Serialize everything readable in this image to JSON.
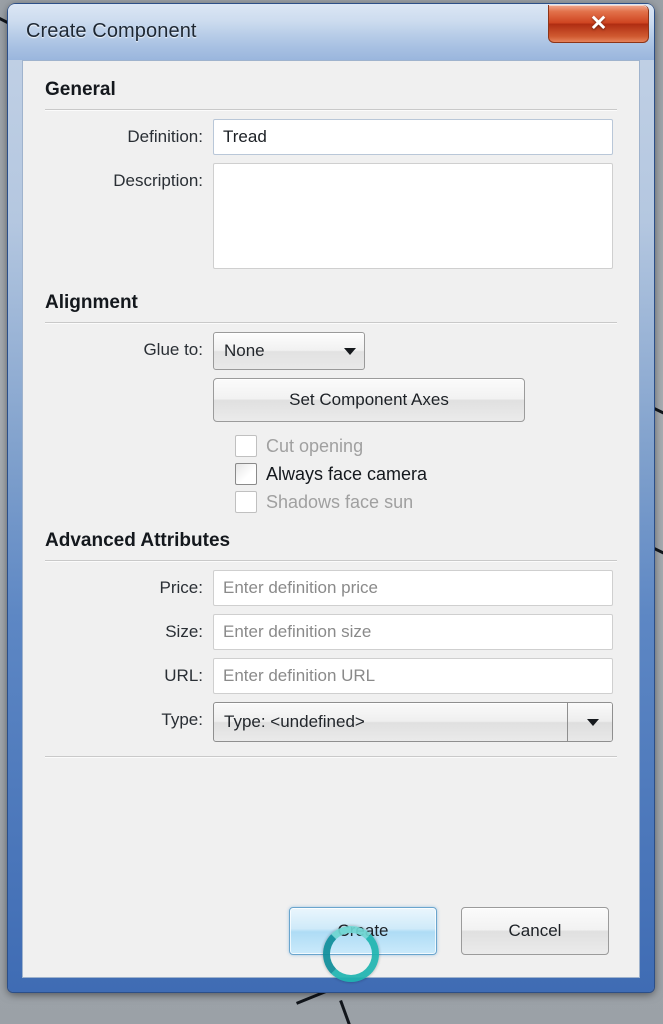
{
  "window": {
    "title": "Create Component",
    "close_label": "✕",
    "accent_color": "#3f6cb4",
    "close_color": "#cf4521"
  },
  "sections": {
    "general": {
      "title": "General",
      "definition": {
        "label": "Definition:",
        "value": "Tread"
      },
      "description": {
        "label": "Description:",
        "value": ""
      }
    },
    "alignment": {
      "title": "Alignment",
      "glue_to": {
        "label": "Glue to:",
        "value": "None"
      },
      "set_axes_button": "Set Component Axes",
      "checkboxes": [
        {
          "label": "Cut opening",
          "checked": false,
          "enabled": false
        },
        {
          "label": "Always face camera",
          "checked": false,
          "enabled": true
        },
        {
          "label": "Shadows face sun",
          "checked": false,
          "enabled": false
        }
      ]
    },
    "advanced": {
      "title": "Advanced Attributes",
      "price": {
        "label": "Price:",
        "value": "",
        "placeholder": "Enter definition price"
      },
      "size": {
        "label": "Size:",
        "value": "",
        "placeholder": "Enter definition size"
      },
      "url": {
        "label": "URL:",
        "value": "",
        "placeholder": "Enter definition URL"
      },
      "type": {
        "label": "Type:",
        "value": "Type: <undefined>"
      }
    }
  },
  "footer": {
    "create_label": "Create",
    "cancel_label": "Cancel"
  },
  "icons": {
    "caret_down": "▼",
    "busy_ring": "busy-ring-cursor"
  }
}
